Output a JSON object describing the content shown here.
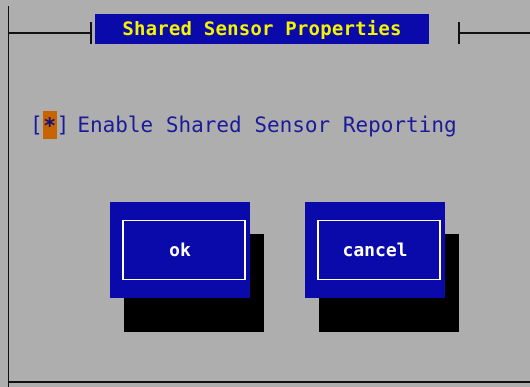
{
  "dialog": {
    "title": "Shared Sensor Properties"
  },
  "checkbox": {
    "left_bracket": "[",
    "mark": "*",
    "right_bracket": "]",
    "label": "Enable Shared Sensor Reporting",
    "checked": true
  },
  "buttons": {
    "ok_label": "ok",
    "cancel_label": "cancel"
  },
  "colors": {
    "background": "#aeaeae",
    "title_bg": "#0a0aaa",
    "title_fg": "#f4f400",
    "button_bg": "#0a0aaa",
    "checkbox_mark_bg": "#c86400",
    "text": "#1a1a9a"
  }
}
